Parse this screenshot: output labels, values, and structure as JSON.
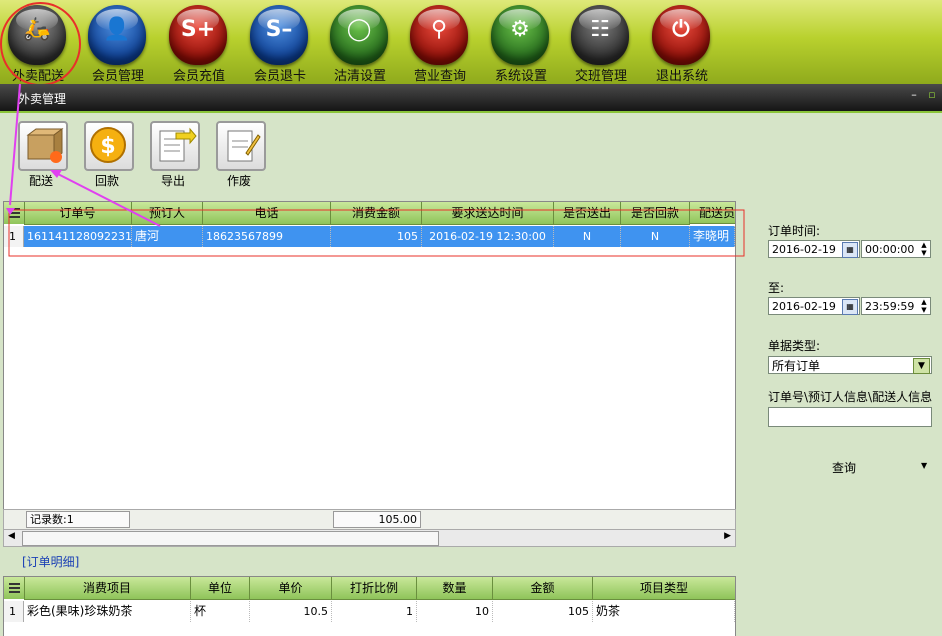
{
  "topbar": {
    "items": [
      {
        "label": "外卖配送",
        "icon": "scooter-icon",
        "color": "gray"
      },
      {
        "label": "会员管理",
        "icon": "person-icon",
        "color": "blue"
      },
      {
        "label": "会员充值",
        "icon": "card-plus-icon",
        "color": "red"
      },
      {
        "label": "会员退卡",
        "icon": "card-minus-icon",
        "color": "blue"
      },
      {
        "label": "沽清设置",
        "icon": "plate-icon",
        "color": "green"
      },
      {
        "label": "营业查询",
        "icon": "magnifier-icon",
        "color": "red"
      },
      {
        "label": "系统设置",
        "icon": "gear-icon",
        "color": "green"
      },
      {
        "label": "交班管理",
        "icon": "meeting-icon",
        "color": "dark"
      },
      {
        "label": "退出系统",
        "icon": "power-icon",
        "color": "red"
      }
    ]
  },
  "window": {
    "title": "外卖管理",
    "min_glyph": "–",
    "max_glyph": "▫"
  },
  "actions": [
    {
      "label": "配送",
      "icon": "box-gear-icon"
    },
    {
      "label": "回款",
      "icon": "coin-icon"
    },
    {
      "label": "导出",
      "icon": "export-icon"
    },
    {
      "label": "作废",
      "icon": "void-note-icon"
    }
  ],
  "orders": {
    "columns": [
      "订单号",
      "预订人",
      "电话",
      "消费金额",
      "要求送达时间",
      "是否送出",
      "是否回款",
      "配送员"
    ],
    "rows": [
      {
        "num": "1",
        "order_no": "161141128092231",
        "customer": "唐河",
        "phone": "18623567899",
        "amount": "105",
        "due": "2016-02-19 12:30:00",
        "sent": "N",
        "paid": "N",
        "courier": "李晓明"
      }
    ],
    "footer": {
      "count_label": "记录数:1",
      "total": "105.00"
    }
  },
  "detail": {
    "title": "[订单明细]",
    "columns": [
      "消费项目",
      "单位",
      "单价",
      "打折比例",
      "数量",
      "金额",
      "项目类型"
    ],
    "rows": [
      {
        "num": "1",
        "item": "彩色(果味)珍珠奶茶",
        "unit": "杯",
        "price": "10.5",
        "discount": "1",
        "qty": "10",
        "amount": "105",
        "type": "奶茶"
      }
    ]
  },
  "filters": {
    "time_label": "订单时间:",
    "start_date": "2016-02-19",
    "start_time": "00:00:00",
    "to_label": "至:",
    "end_date": "2016-02-19",
    "end_time": "23:59:59",
    "type_label": "单据类型:",
    "type_value": "所有订单",
    "search_label": "订单号\\预订人信息\\配送人信息",
    "search_value": "",
    "query_label": "查询"
  },
  "colors": {
    "accent": "#8ac43a",
    "selection": "#3f93f0",
    "annotation_red": "#e8302a",
    "annotation_magenta": "#e040f0"
  }
}
